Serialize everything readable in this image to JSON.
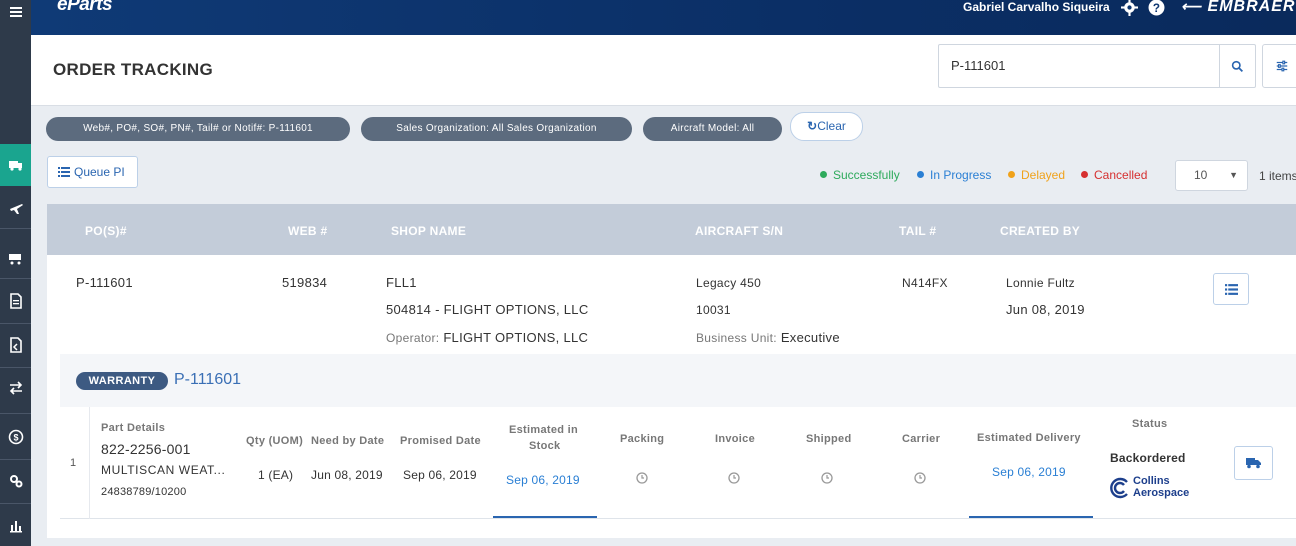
{
  "app": {
    "name": "eParts",
    "brand": "EMBRAER"
  },
  "header": {
    "user_name": "Gabriel Carvalho Siqueira"
  },
  "page": {
    "title": "ORDER TRACKING"
  },
  "search": {
    "value": "P-111601"
  },
  "filters": {
    "chips": [
      "Web#, PO#, SO#, PN#, Tail# or Notif#: P-111601",
      "Sales Organization: All Sales Organization",
      "Aircraft Model: All"
    ],
    "clear_label": "Clear"
  },
  "toolbar": {
    "queue_label": "Queue PI",
    "legend": [
      {
        "label": "Successfully",
        "color": "#2eaa5c"
      },
      {
        "label": "In Progress",
        "color": "#2a7fd4"
      },
      {
        "label": "Delayed",
        "color": "#f0a21b"
      },
      {
        "label": "Cancelled",
        "color": "#d63030"
      }
    ],
    "page_size": "10",
    "items_count": "1 items"
  },
  "table": {
    "headers": [
      "PO(S)#",
      "WEB #",
      "SHOP NAME",
      "AIRCRAFT S/N",
      "TAIL #",
      "CREATED BY"
    ],
    "row": {
      "po": "P-111601",
      "web": "519834",
      "shop_code": "FLL1",
      "shop_name": "504814 - FLIGHT OPTIONS, LLC",
      "operator_label": "Operator:",
      "operator": "FLIGHT OPTIONS, LLC",
      "aircraft_model": "Legacy 450",
      "aircraft_sn": "10031",
      "business_unit_label": "Business Unit:",
      "business_unit": "Executive",
      "tail": "N414FX",
      "created_by": "Lonnie Fultz",
      "created_date": "Jun 08, 2019"
    }
  },
  "warranty": {
    "badge": "WARRANTY",
    "po": "P-111601",
    "headers": {
      "part_details": "Part Details",
      "qty": "Qty (UOM)",
      "need_by": "Need by Date",
      "promised": "Promised Date",
      "est_stock_1": "Estimated in",
      "est_stock_2": "Stock",
      "packing": "Packing",
      "invoice": "Invoice",
      "shipped": "Shipped",
      "carrier": "Carrier",
      "est_delivery": "Estimated Delivery",
      "status": "Status"
    },
    "line": {
      "index": "1",
      "part_number": "822-2256-001",
      "description": "MULTISCAN WEAT...",
      "reference": "24838789/10200",
      "qty": "1 (EA)",
      "need_by": "Jun 08, 2019",
      "promised": "Sep 06, 2019",
      "est_stock": "Sep 06, 2019",
      "est_delivery": "Sep 06, 2019",
      "status": "Backordered",
      "supplier_line1": "Collins",
      "supplier_line2": "Aerospace"
    }
  },
  "sidebar": {
    "icons": [
      "menu-icon",
      "truck-icon",
      "plane-icon",
      "cart-icon",
      "document-icon",
      "exchange-document-icon",
      "transfer-icon",
      "dollar-icon",
      "settings-icon",
      "bar-chart-icon"
    ]
  }
}
